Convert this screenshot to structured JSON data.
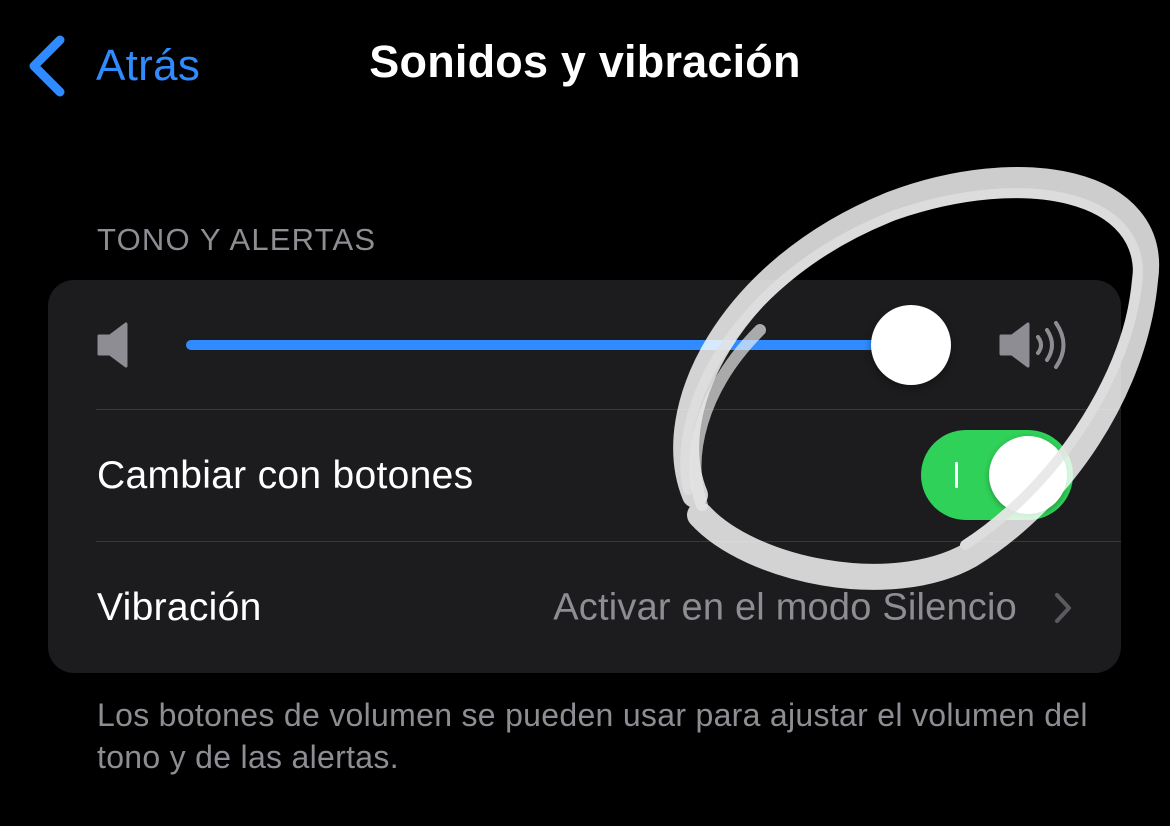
{
  "nav": {
    "back_label": "Atrás",
    "title": "Sonidos y vibración"
  },
  "section": {
    "header": "TONO Y ALERTAS"
  },
  "volume": {
    "level_fraction": 0.98
  },
  "rows": {
    "change_with_buttons": {
      "label": "Cambiar con botones",
      "enabled": true
    },
    "vibration": {
      "label": "Vibración",
      "value": "Activar en el modo Silencio"
    }
  },
  "footer": {
    "note": "Los botones de volumen se pueden usar para ajustar el volumen del tono y de las alertas."
  },
  "icons": {
    "back": "chevron-left-icon",
    "volume_low": "speaker-low-icon",
    "volume_high": "speaker-high-icon",
    "disclosure": "chevron-right-icon"
  },
  "colors": {
    "background": "#000000",
    "card": "#1c1c1e",
    "accent_blue": "#2f8bff",
    "toggle_green": "#30d158",
    "secondary_text": "#8d8d93",
    "annotation": "#ffffff"
  }
}
